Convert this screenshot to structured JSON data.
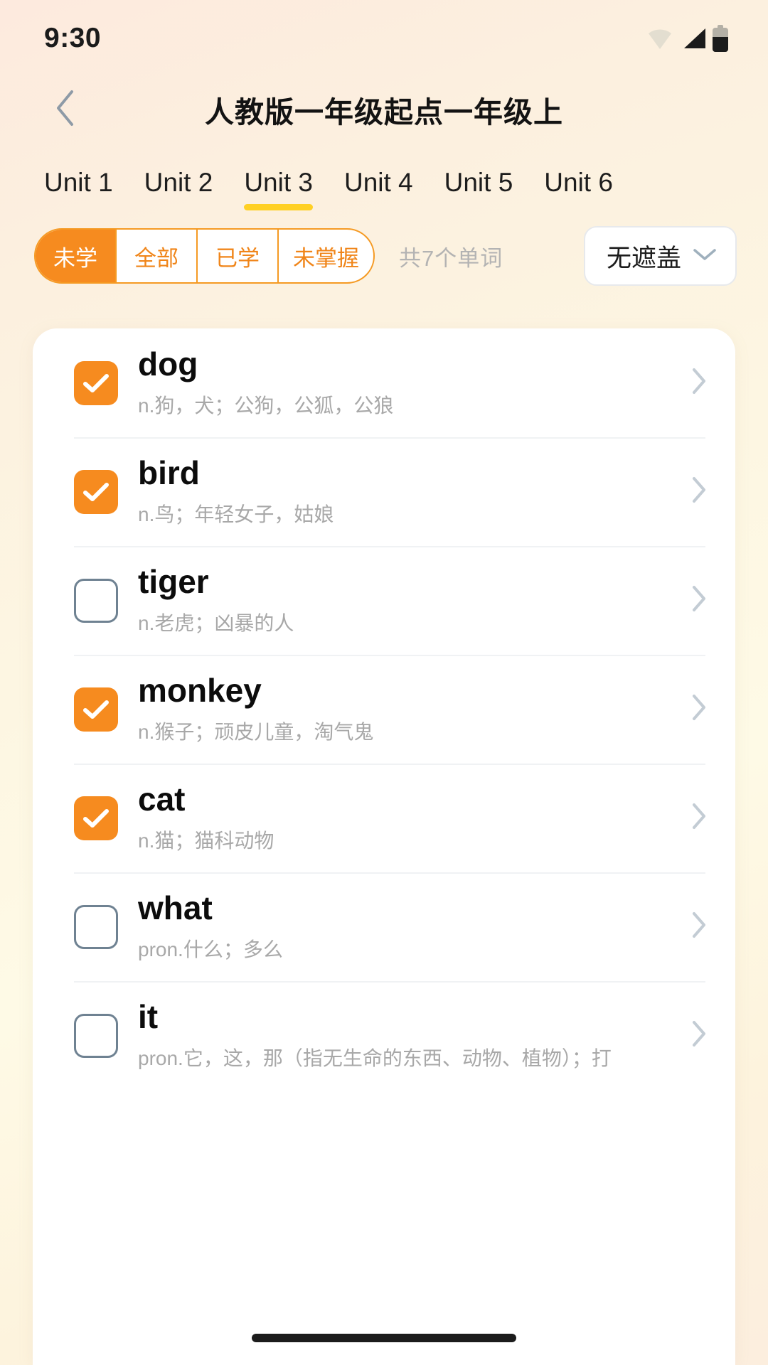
{
  "status_bar": {
    "time": "9:30",
    "icons": [
      "wifi-icon",
      "cellular-signal-icon",
      "battery-icon"
    ]
  },
  "nav": {
    "back_icon": "chevron-left-icon",
    "title": "人教版一年级起点一年级上"
  },
  "unit_tabs": {
    "active_index": 2,
    "items": [
      {
        "label": "Unit 1"
      },
      {
        "label": "Unit 2"
      },
      {
        "label": "Unit 3"
      },
      {
        "label": "Unit 4"
      },
      {
        "label": "Unit 5"
      },
      {
        "label": "Unit 6"
      }
    ],
    "active_underline_color": "#ffd024"
  },
  "filters": {
    "segments": [
      {
        "label": "未学",
        "active": true
      },
      {
        "label": "全部",
        "active": false
      },
      {
        "label": "已学",
        "active": false
      },
      {
        "label": "未掌握",
        "active": false
      }
    ],
    "total_text": "共7个单词",
    "mask_select": {
      "value": "无遮盖",
      "chevron_icon": "chevron-down-icon"
    },
    "accent_color": "#f68b1f"
  },
  "word_list": {
    "row_chevron_icon": "chevron-right-icon",
    "rows": [
      {
        "checked": true,
        "term": "dog",
        "definition": "n.狗，犬；公狗，公狐，公狼"
      },
      {
        "checked": true,
        "term": "bird",
        "definition": "n.鸟；年轻女子，姑娘"
      },
      {
        "checked": false,
        "term": "tiger",
        "definition": "n.老虎；凶暴的人"
      },
      {
        "checked": true,
        "term": "monkey",
        "definition": "n.猴子；顽皮儿童，淘气鬼"
      },
      {
        "checked": true,
        "term": "cat",
        "definition": "n.猫；猫科动物"
      },
      {
        "checked": false,
        "term": "what",
        "definition": "pron.什么；多么"
      },
      {
        "checked": false,
        "term": "it",
        "definition": "pron.它，这，那（指无生命的东西、动物、植物）；打"
      }
    ]
  }
}
